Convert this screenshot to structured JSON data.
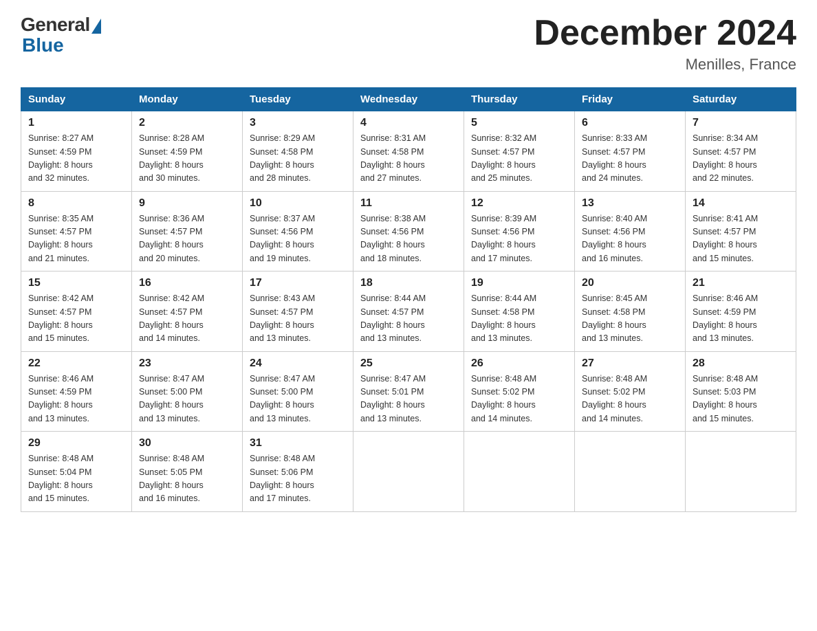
{
  "logo": {
    "general": "General",
    "blue": "Blue"
  },
  "title": "December 2024",
  "location": "Menilles, France",
  "days_of_week": [
    "Sunday",
    "Monday",
    "Tuesday",
    "Wednesday",
    "Thursday",
    "Friday",
    "Saturday"
  ],
  "weeks": [
    [
      {
        "day": "1",
        "sunrise": "8:27 AM",
        "sunset": "4:59 PM",
        "daylight": "8 hours and 32 minutes."
      },
      {
        "day": "2",
        "sunrise": "8:28 AM",
        "sunset": "4:59 PM",
        "daylight": "8 hours and 30 minutes."
      },
      {
        "day": "3",
        "sunrise": "8:29 AM",
        "sunset": "4:58 PM",
        "daylight": "8 hours and 28 minutes."
      },
      {
        "day": "4",
        "sunrise": "8:31 AM",
        "sunset": "4:58 PM",
        "daylight": "8 hours and 27 minutes."
      },
      {
        "day": "5",
        "sunrise": "8:32 AM",
        "sunset": "4:57 PM",
        "daylight": "8 hours and 25 minutes."
      },
      {
        "day": "6",
        "sunrise": "8:33 AM",
        "sunset": "4:57 PM",
        "daylight": "8 hours and 24 minutes."
      },
      {
        "day": "7",
        "sunrise": "8:34 AM",
        "sunset": "4:57 PM",
        "daylight": "8 hours and 22 minutes."
      }
    ],
    [
      {
        "day": "8",
        "sunrise": "8:35 AM",
        "sunset": "4:57 PM",
        "daylight": "8 hours and 21 minutes."
      },
      {
        "day": "9",
        "sunrise": "8:36 AM",
        "sunset": "4:57 PM",
        "daylight": "8 hours and 20 minutes."
      },
      {
        "day": "10",
        "sunrise": "8:37 AM",
        "sunset": "4:56 PM",
        "daylight": "8 hours and 19 minutes."
      },
      {
        "day": "11",
        "sunrise": "8:38 AM",
        "sunset": "4:56 PM",
        "daylight": "8 hours and 18 minutes."
      },
      {
        "day": "12",
        "sunrise": "8:39 AM",
        "sunset": "4:56 PM",
        "daylight": "8 hours and 17 minutes."
      },
      {
        "day": "13",
        "sunrise": "8:40 AM",
        "sunset": "4:56 PM",
        "daylight": "8 hours and 16 minutes."
      },
      {
        "day": "14",
        "sunrise": "8:41 AM",
        "sunset": "4:57 PM",
        "daylight": "8 hours and 15 minutes."
      }
    ],
    [
      {
        "day": "15",
        "sunrise": "8:42 AM",
        "sunset": "4:57 PM",
        "daylight": "8 hours and 15 minutes."
      },
      {
        "day": "16",
        "sunrise": "8:42 AM",
        "sunset": "4:57 PM",
        "daylight": "8 hours and 14 minutes."
      },
      {
        "day": "17",
        "sunrise": "8:43 AM",
        "sunset": "4:57 PM",
        "daylight": "8 hours and 13 minutes."
      },
      {
        "day": "18",
        "sunrise": "8:44 AM",
        "sunset": "4:57 PM",
        "daylight": "8 hours and 13 minutes."
      },
      {
        "day": "19",
        "sunrise": "8:44 AM",
        "sunset": "4:58 PM",
        "daylight": "8 hours and 13 minutes."
      },
      {
        "day": "20",
        "sunrise": "8:45 AM",
        "sunset": "4:58 PM",
        "daylight": "8 hours and 13 minutes."
      },
      {
        "day": "21",
        "sunrise": "8:46 AM",
        "sunset": "4:59 PM",
        "daylight": "8 hours and 13 minutes."
      }
    ],
    [
      {
        "day": "22",
        "sunrise": "8:46 AM",
        "sunset": "4:59 PM",
        "daylight": "8 hours and 13 minutes."
      },
      {
        "day": "23",
        "sunrise": "8:47 AM",
        "sunset": "5:00 PM",
        "daylight": "8 hours and 13 minutes."
      },
      {
        "day": "24",
        "sunrise": "8:47 AM",
        "sunset": "5:00 PM",
        "daylight": "8 hours and 13 minutes."
      },
      {
        "day": "25",
        "sunrise": "8:47 AM",
        "sunset": "5:01 PM",
        "daylight": "8 hours and 13 minutes."
      },
      {
        "day": "26",
        "sunrise": "8:48 AM",
        "sunset": "5:02 PM",
        "daylight": "8 hours and 14 minutes."
      },
      {
        "day": "27",
        "sunrise": "8:48 AM",
        "sunset": "5:02 PM",
        "daylight": "8 hours and 14 minutes."
      },
      {
        "day": "28",
        "sunrise": "8:48 AM",
        "sunset": "5:03 PM",
        "daylight": "8 hours and 15 minutes."
      }
    ],
    [
      {
        "day": "29",
        "sunrise": "8:48 AM",
        "sunset": "5:04 PM",
        "daylight": "8 hours and 15 minutes."
      },
      {
        "day": "30",
        "sunrise": "8:48 AM",
        "sunset": "5:05 PM",
        "daylight": "8 hours and 16 minutes."
      },
      {
        "day": "31",
        "sunrise": "8:48 AM",
        "sunset": "5:06 PM",
        "daylight": "8 hours and 17 minutes."
      },
      null,
      null,
      null,
      null
    ]
  ],
  "labels": {
    "sunrise": "Sunrise:",
    "sunset": "Sunset:",
    "daylight": "Daylight:"
  }
}
